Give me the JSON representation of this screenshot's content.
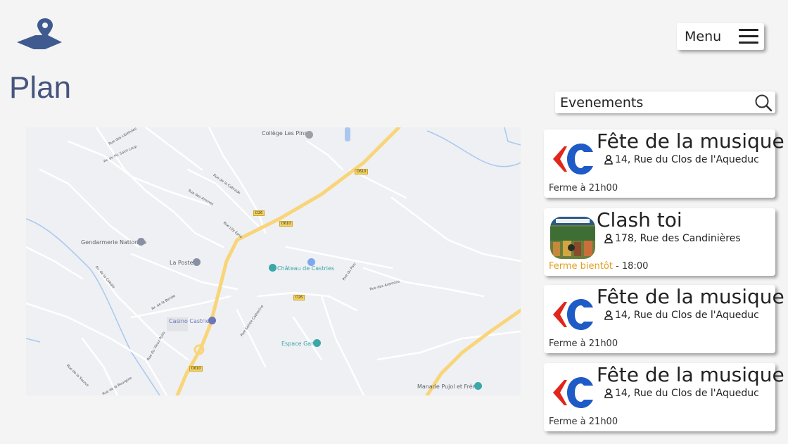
{
  "header": {
    "menu_label": "Menu",
    "page_title": "Plan"
  },
  "search": {
    "placeholder": "Evenements",
    "value": ""
  },
  "map": {
    "places": {
      "college": "Collège Les Pins",
      "gendarmerie": "Gendarmerie Nationale",
      "poste": "La Poste",
      "chateau": "Château de Castries",
      "casino": "Casino Castries",
      "espace_gare": "Espace Gare",
      "manade": "Manade Pujol et Frères"
    },
    "roads": {
      "r1": "Rue des Libellules",
      "r2": "Av. du Pic Saint Loup",
      "r3": "Rue de la Cabrade",
      "r4": "Rue des Aromes",
      "r5": "Rue Lily Epsa",
      "r6": "Av. de la Bende",
      "r7": "Av. de la Cabale",
      "r8": "Rue Sainte Catherine",
      "r9": "Rue du Parc",
      "r10": "Rue des Aramons",
      "r11": "Rue du Vieux Puits",
      "r12": "Rue de la Source",
      "r13": "Rue de la Bourgine"
    },
    "road_tags": {
      "d610": "D610",
      "d26": "D26"
    }
  },
  "events": [
    {
      "title": "Fête de la musique",
      "address": "14, Rue du Clos de l'Aqueduc",
      "status": "Ferme à 21h00",
      "status_warn": "",
      "thumb": "carrefour-logo"
    },
    {
      "title": "Clash toi",
      "address": "178, Rue des Candinières",
      "status": " - 18:00",
      "status_warn": "Ferme bientôt",
      "thumb": "store-photo"
    },
    {
      "title": "Fête de la musique",
      "address": "14, Rue du Clos de l'Aqueduc",
      "status": "Ferme à 21h00",
      "status_warn": "",
      "thumb": "carrefour-logo"
    },
    {
      "title": "Fête de la musique",
      "address": "14, Rue du Clos de l'Aqueduc",
      "status": "Ferme à 21h00",
      "status_warn": "",
      "thumb": "carrefour-logo"
    }
  ],
  "colors": {
    "title": "#45557f",
    "accent_warn": "#e0a020",
    "carrefour_red": "#e1261c",
    "carrefour_blue": "#1e5bc6",
    "major_road": "#f9d57a"
  }
}
